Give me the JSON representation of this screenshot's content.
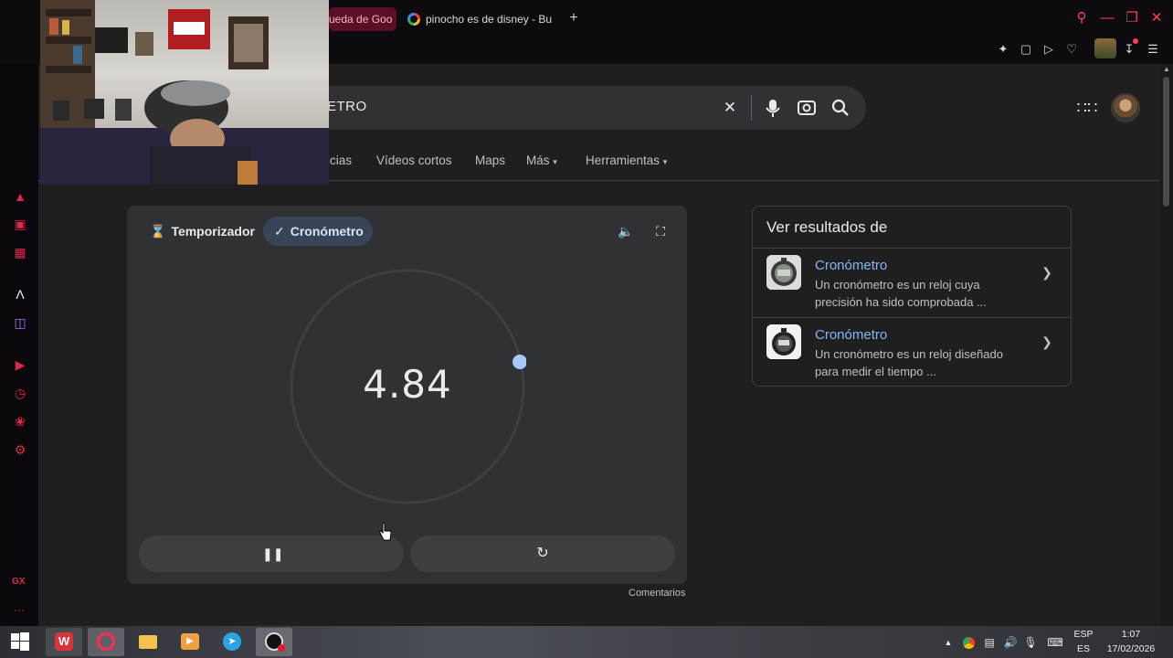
{
  "browser": {
    "tabs": [
      {
        "label": "ueda de Goo",
        "active": true
      },
      {
        "label": "pinocho es de disney - Bu",
        "active": false
      }
    ],
    "new_tab": "+"
  },
  "search": {
    "query": "ETRO",
    "nav": [
      "icias",
      "Vídeos cortos",
      "Maps",
      "Más",
      "Herramientas"
    ]
  },
  "stopwatch": {
    "tab_timer": "Temporizador",
    "tab_stopwatch": "Cronómetro",
    "time": "4.84",
    "feedback": "Comentarios",
    "accent": "#a8c7fa"
  },
  "results_panel": {
    "title": "Ver resultados de",
    "items": [
      {
        "title": "Cronómetro",
        "desc": "Un cronómetro es un reloj cuya precisión ha sido comprobada ..."
      },
      {
        "title": "Cronómetro",
        "desc": "Un cronómetro es un reloj diseñado para medir el tiempo ..."
      }
    ]
  },
  "taskbar": {
    "lang_top": "ESP",
    "lang_bottom": "ES",
    "time": "1:07",
    "date": "17/02/2026"
  },
  "sidebar": {
    "gx": "GX",
    "more": "···"
  }
}
